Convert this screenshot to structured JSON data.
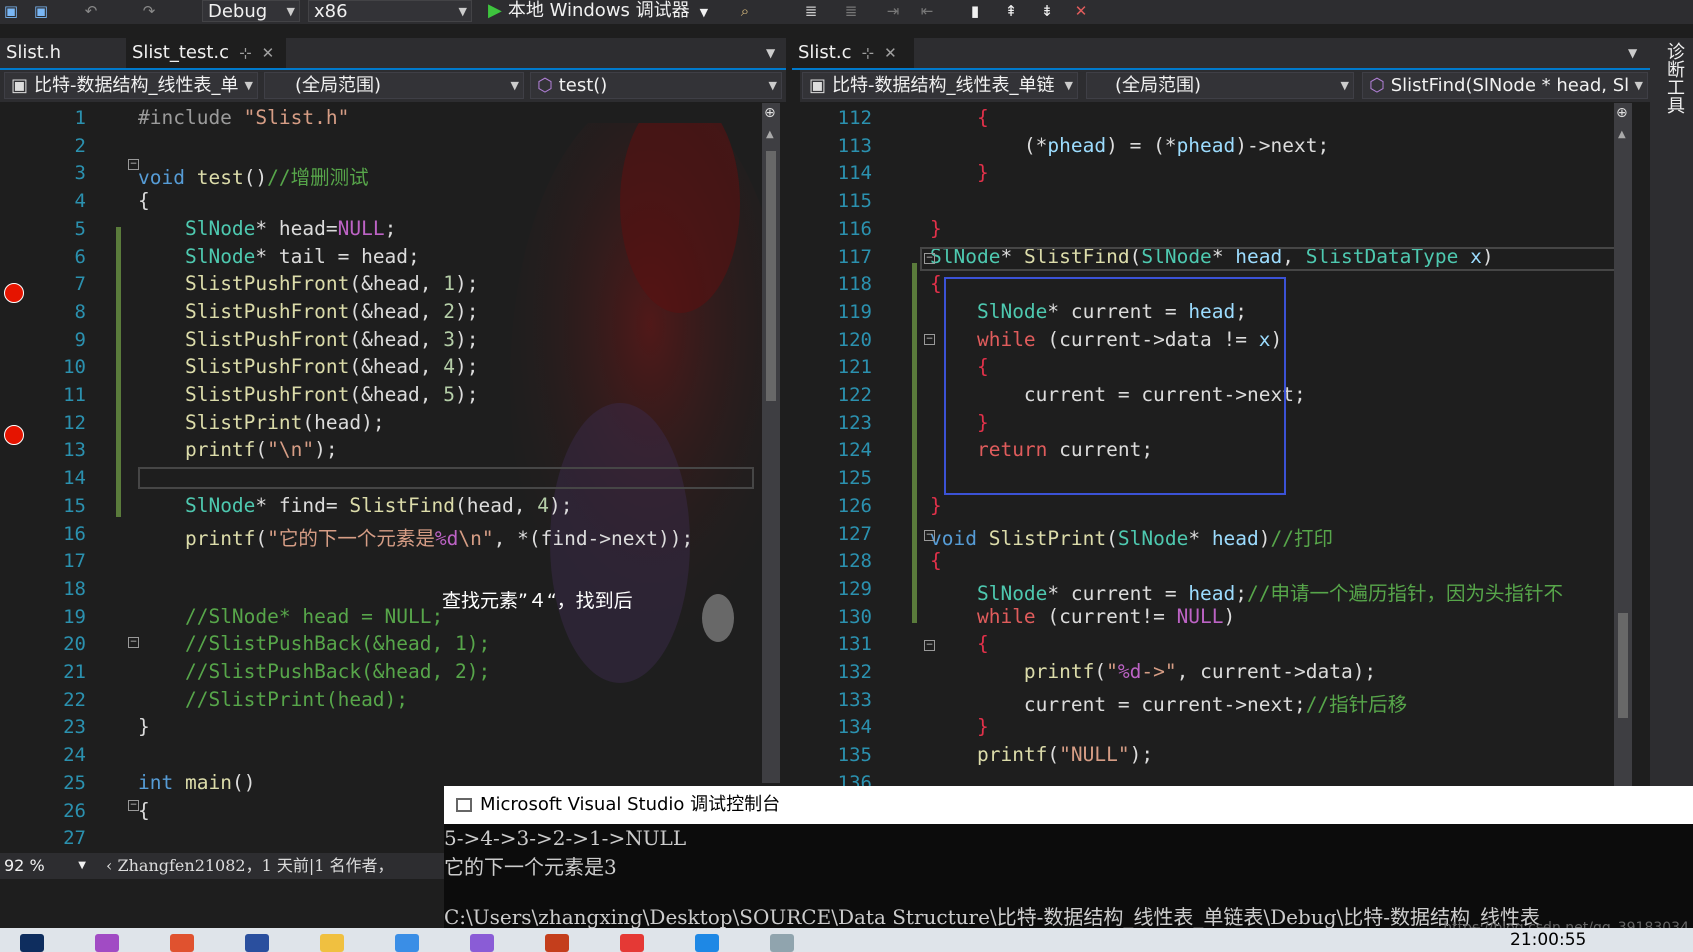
{
  "toolbar": {
    "config": "Debug",
    "platform": "x86",
    "run_label": "本地 Windows 调试器"
  },
  "left_pane": {
    "tabs": [
      {
        "label": "Slist.h",
        "active": false
      },
      {
        "label": "Slist_test.c",
        "active": true
      }
    ],
    "nav": {
      "project": "比特-数据结构_线性表_单",
      "scope": "(全局范围)",
      "member": "test()"
    },
    "zoom": "92 %",
    "codelens": "Zhangfen21082，1 天前|1 名作者，"
  },
  "right_pane": {
    "tabs": [
      {
        "label": "Slist.c",
        "active": true
      }
    ],
    "nav": {
      "project": "比特-数据结构_线性表_单链",
      "scope": "(全局范围)",
      "member": "SlistFind(SlNode * head, Sl"
    },
    "side_tool": "诊断工具"
  },
  "annotation": "查找元素”４“，找到后",
  "console": {
    "title": "Microsoft Visual Studio 调试控制台",
    "lines": [
      "5->4->3->2->1->NULL",
      "它的下一个元素是3",
      "",
      "C:\\Users\\zhangxing\\Desktop\\SOURCE\\Data Structure\\比特-数据结构_线性表_单链表\\Debug\\比特-数据结构_线性表_"
    ]
  },
  "watermark": "https://blog.csdn.net/qq_39183034",
  "clock": "21:00:55",
  "icons": [
    "save-icon",
    "undo-icon",
    "redo-icon",
    "play-icon",
    "pin-icon",
    "close-icon",
    "function-icon",
    "breakpoint-icon"
  ],
  "colors": {
    "accent": "#007acc",
    "breakpoint": "#e51400",
    "keyword": "#569cd6",
    "type": "#4ec9b0",
    "comment": "#57a64a",
    "string": "#d69d85"
  }
}
